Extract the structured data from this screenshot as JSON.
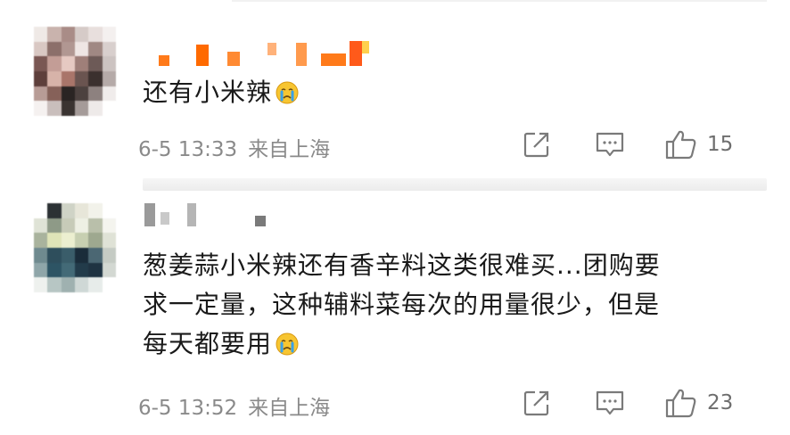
{
  "comments": [
    {
      "text_lines": [
        "还有小米辣"
      ],
      "emoji": "crying-face-emoji",
      "date": "6-5 13:33",
      "location": "来自上海",
      "likes": "15",
      "icons": {
        "share": "share-icon",
        "comment": "comment-icon",
        "like": "thumbs-up-icon"
      }
    },
    {
      "text_lines": [
        "葱姜蒜小米辣还有香辛料这类很难买...团购要",
        "求一定量，这种辅料菜每次的用量很少，但是",
        "每天都要用"
      ],
      "emoji": "crying-face-emoji",
      "date": "6-5 13:52",
      "location": "来自上海",
      "likes": "23",
      "icons": {
        "share": "share-icon",
        "comment": "comment-icon",
        "like": "thumbs-up-icon"
      }
    }
  ],
  "colors": {
    "text": "#1a1a1a",
    "meta": "#8a8a8a",
    "icon": "#7a7a7a",
    "username_blur": "#ff6a00"
  }
}
